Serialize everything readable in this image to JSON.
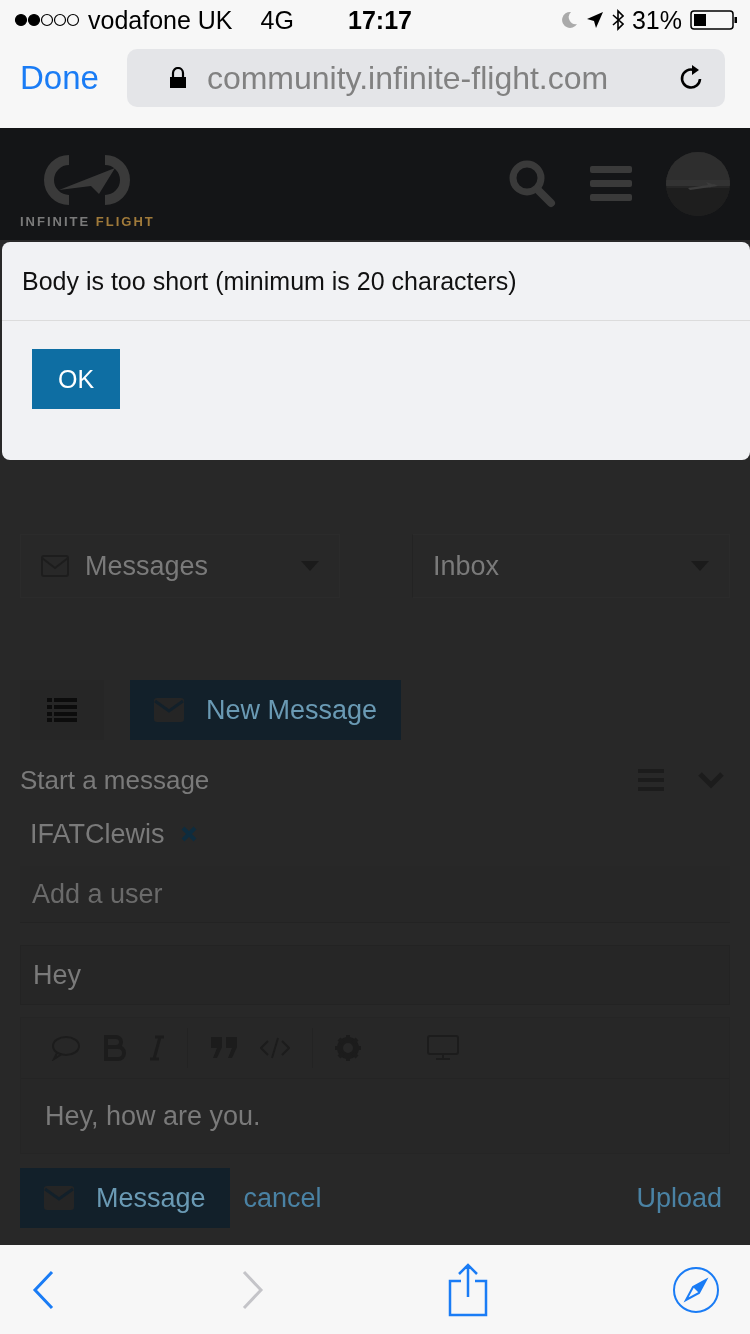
{
  "status_bar": {
    "carrier": "vodafone UK",
    "network": "4G",
    "time": "17:17",
    "battery": "31%"
  },
  "browser": {
    "done": "Done",
    "url": "community.infinite-flight.com"
  },
  "header": {
    "logo_word_1": "INFINITE",
    "logo_word_2": "FLIGHT"
  },
  "dialog": {
    "message": "Body is too short (minimum is 20 characters)",
    "button": "OK"
  },
  "filters": [
    {
      "label": "Messages",
      "kind": "mail"
    },
    {
      "label": "Inbox",
      "kind": "plain"
    }
  ],
  "new_message_button": "New Message",
  "composer": {
    "title": "Start a message",
    "recipients": [
      {
        "name": "IFATClewis"
      }
    ],
    "user_placeholder": "Add a user",
    "subject": "Hey",
    "body": "Hey, how are you.",
    "submit": "Message",
    "cancel": "cancel",
    "upload": "Upload"
  },
  "toolbar": [
    {
      "kind": "back",
      "disabled": false
    },
    {
      "kind": "forward",
      "disabled": true
    },
    {
      "kind": "share",
      "disabled": false
    },
    {
      "kind": "compass",
      "disabled": false
    }
  ]
}
